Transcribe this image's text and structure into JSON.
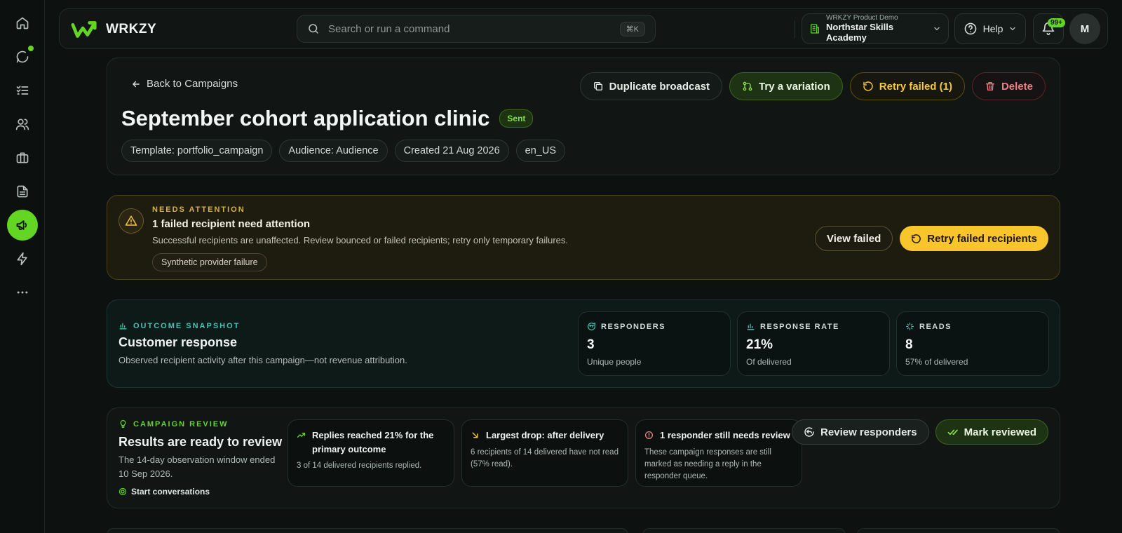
{
  "brand": {
    "name": "WRKZY"
  },
  "search": {
    "placeholder": "Search or run a command",
    "shortcut": "⌘K"
  },
  "workspace": {
    "org": "WRKZY Product Demo",
    "name": "Northstar Skills Academy"
  },
  "help": {
    "label": "Help"
  },
  "notifications": {
    "count": "99+"
  },
  "user": {
    "initial": "M"
  },
  "sidebar": {
    "items": [
      {
        "icon": "home-icon"
      },
      {
        "icon": "chat-icon"
      },
      {
        "icon": "tasks-icon"
      },
      {
        "icon": "users-icon"
      },
      {
        "icon": "briefcase-icon"
      },
      {
        "icon": "document-icon"
      },
      {
        "icon": "megaphone-icon"
      },
      {
        "icon": "bolt-icon"
      },
      {
        "icon": "more-icon"
      }
    ]
  },
  "campaign": {
    "back_label": "Back to Campaigns",
    "title": "September cohort application clinic",
    "status": "Sent",
    "chips": [
      "Template: portfolio_campaign",
      "Audience: Audience",
      "Created 21 Aug 2026",
      "en_US"
    ],
    "actions": {
      "duplicate": "Duplicate broadcast",
      "variation": "Try a variation",
      "retry": "Retry failed (1)",
      "delete": "Delete"
    }
  },
  "attention": {
    "eyebrow": "NEEDS ATTENTION",
    "title": "1 failed recipient need attention",
    "description": "Successful recipients are unaffected. Review bounced or failed recipients; retry only temporary failures.",
    "tag": "Synthetic provider failure",
    "view_label": "View failed",
    "retry_label": "Retry failed recipients"
  },
  "outcome": {
    "eyebrow": "OUTCOME SNAPSHOT",
    "title": "Customer response",
    "description": "Observed recipient activity after this campaign—not revenue attribution.",
    "stats": [
      {
        "label": "RESPONDERS",
        "value": "3",
        "sub": "Unique people"
      },
      {
        "label": "RESPONSE RATE",
        "value": "21%",
        "sub": "Of delivered"
      },
      {
        "label": "READS",
        "value": "8",
        "sub": "57% of delivered"
      }
    ]
  },
  "review": {
    "eyebrow": "CAMPAIGN REVIEW",
    "title": "Results are ready to review",
    "description": "The 14-day observation window ended 10 Sep 2026.",
    "link": "Start conversations",
    "cards": [
      {
        "title": "Replies reached 21% for the primary outcome",
        "body": "3 of 14 delivered recipients replied."
      },
      {
        "title": "Largest drop: after delivery",
        "body": "6 recipients of 14 delivered have not read (57% read)."
      },
      {
        "title": "1 responder still needs review",
        "body": "These campaign responses are still marked as needing a reply in the responder queue."
      }
    ],
    "review_label": "Review responders",
    "mark_label": "Mark reviewed"
  },
  "colors": {
    "accent": "#63d624",
    "warning": "#f8c52c",
    "danger": "#ef7f84",
    "teal": "#3fc6b0"
  }
}
